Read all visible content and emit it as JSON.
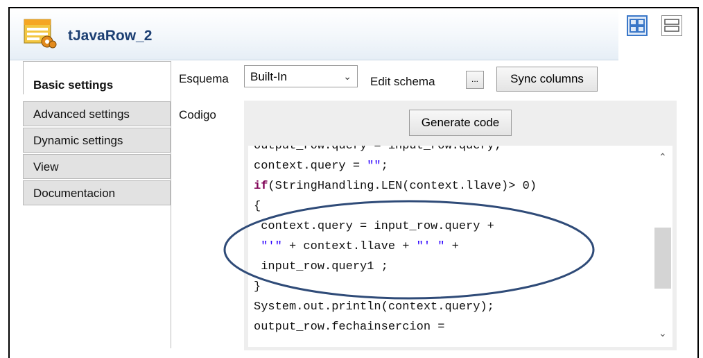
{
  "component": {
    "title": "tJavaRow_2",
    "icon": "java-row-component-icon"
  },
  "view_toggle": {
    "icons": [
      "tabular-view-icon",
      "list-view-icon"
    ]
  },
  "tabs": [
    {
      "label": "Basic settings",
      "active": true
    },
    {
      "label": "Advanced settings"
    },
    {
      "label": "Dynamic settings"
    },
    {
      "label": "View"
    },
    {
      "label": "Documentacion"
    }
  ],
  "schema": {
    "label": "Esquema",
    "selected": "Built-In",
    "edit_label": "Edit schema",
    "ellipsis": "...",
    "sync_label": "Sync columns"
  },
  "code_section": {
    "label": "Codigo",
    "generate_label": "Generate code"
  },
  "colors": {
    "title": "#1c3f73",
    "keyword": "#7f0055",
    "string": "#2a00ff",
    "highlight_ellipse": "#2f4b78"
  }
}
